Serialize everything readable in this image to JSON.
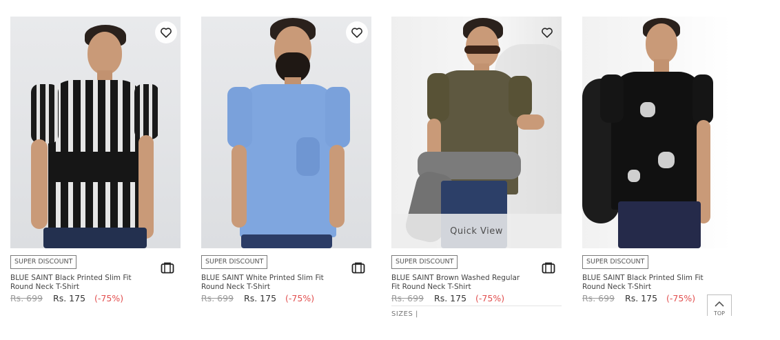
{
  "products": [
    {
      "badge": "SUPER DISCOUNT",
      "name": "BLUE SAINT Black Printed Slim Fit Round Neck T-Shirt",
      "mrp": "Rs. 699",
      "price": "Rs. 175",
      "discount": "(-75%)"
    },
    {
      "badge": "SUPER DISCOUNT",
      "name": "BLUE SAINT White Printed Slim Fit Round Neck T-Shirt",
      "mrp": "Rs. 699",
      "price": "Rs. 175",
      "discount": "(-75%)"
    },
    {
      "badge": "SUPER DISCOUNT",
      "name": "BLUE SAINT Brown Washed Regular Fit Round Neck T-Shirt",
      "mrp": "Rs. 699",
      "price": "Rs. 175",
      "discount": "(-75%)",
      "quick_view": "Quick View",
      "sizes": "SIZES  |"
    },
    {
      "badge": "SUPER DISCOUNT",
      "name": "BLUE SAINT Black Printed Slim Fit Round Neck T-Shirt",
      "mrp": "Rs. 699",
      "price": "Rs. 175",
      "discount": "(-75%)"
    }
  ],
  "icons": {
    "wishlist": "heart-icon",
    "bag": "bag-icon",
    "scroll_top": "chevron-up-icon"
  },
  "scroll_top": {
    "label": "TOP"
  },
  "colors": {
    "discount": "#e24e4e",
    "strike": "#999999"
  }
}
